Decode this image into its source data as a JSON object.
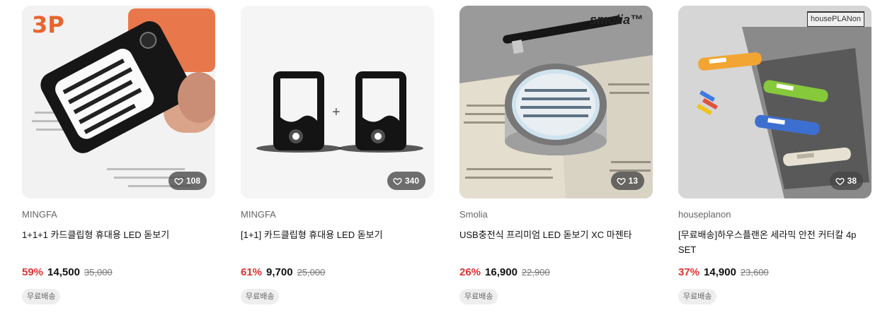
{
  "products": [
    {
      "image_label": "3P",
      "likes": "108",
      "brand": "MINGFA",
      "title": "1+1+1 카드클립형 휴대용 LED 돋보기",
      "discount": "59%",
      "price": "14,500",
      "original_price": "35,000",
      "badge": "무료배송"
    },
    {
      "image_label": "+",
      "likes": "340",
      "brand": "MINGFA",
      "title": "[1+1] 카드클립형 휴대용 LED 돋보기",
      "discount": "61%",
      "price": "9,700",
      "original_price": "25,000",
      "badge": "무료배송"
    },
    {
      "image_label": "smolia™",
      "likes": "13",
      "brand": "Smolia",
      "title": "USB충전식 프리미엄 LED 돋보기 XC 마젠타",
      "discount": "26%",
      "price": "16,900",
      "original_price": "22,900",
      "badge": "무료배송"
    },
    {
      "image_label": "housePLANon",
      "likes": "38",
      "brand": "houseplanon",
      "title": "[무료배송]하우스플랜온 세라믹 안전 커터칼 4p SET",
      "discount": "37%",
      "price": "14,900",
      "original_price": "23,600",
      "badge": "무료배송"
    }
  ],
  "colors": {
    "discount": "#e03131",
    "like_bg": "#464646",
    "badge_bg": "#eeeeee"
  },
  "icons": {
    "like": "heart-outline-icon"
  }
}
